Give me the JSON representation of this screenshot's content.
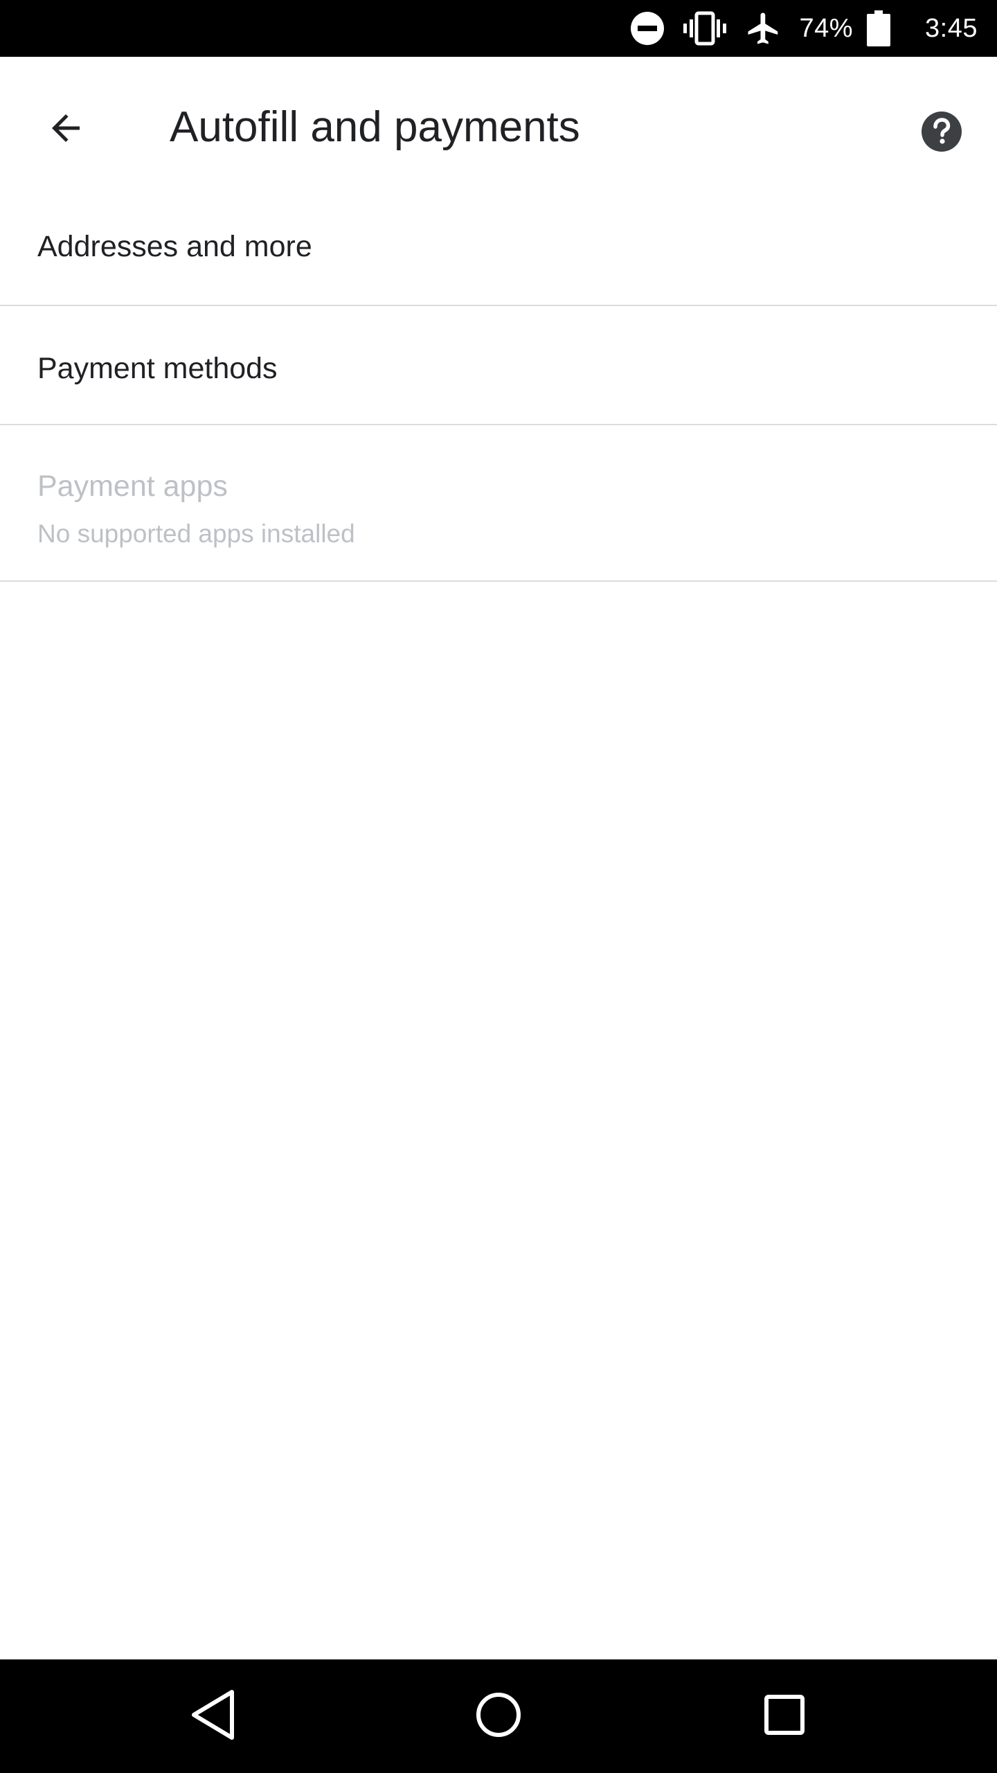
{
  "status_bar": {
    "battery_percent": "74%",
    "time": "3:45",
    "icons": [
      "do-not-disturb-icon",
      "vibrate-icon",
      "airplane-mode-icon",
      "battery-icon"
    ]
  },
  "toolbar": {
    "title": "Autofill and payments",
    "back_icon": "arrow-back-icon",
    "help_icon": "help-icon"
  },
  "settings": {
    "items": [
      {
        "title": "Addresses and more"
      },
      {
        "title": "Payment methods"
      },
      {
        "title": "Payment apps",
        "subtitle": "No supported apps installed",
        "enabled": false
      }
    ]
  },
  "nav_bar": {
    "icons": [
      "nav-back-icon",
      "nav-home-icon",
      "nav-recents-icon"
    ]
  },
  "colors": {
    "text_primary": "#202124",
    "text_disabled": "#bdc1c6",
    "divider": "#dadce0",
    "icon_dark": "#3c4043"
  }
}
